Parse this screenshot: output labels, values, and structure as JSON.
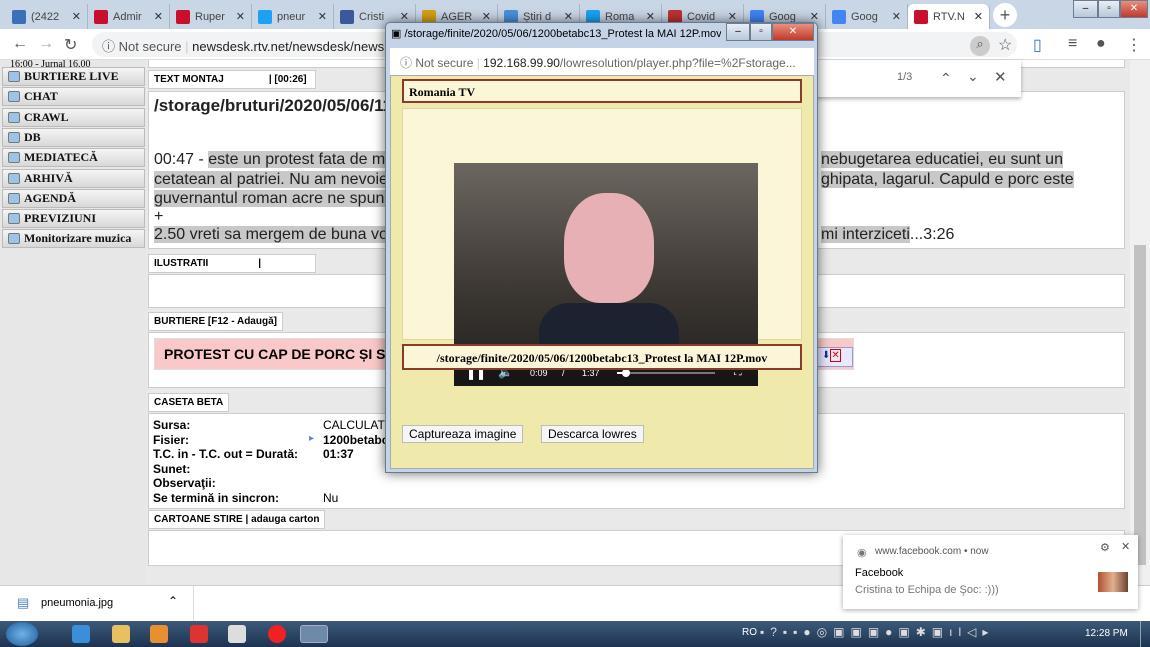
{
  "browser": {
    "tabs": [
      {
        "label": "(2422",
        "icon": "messenger-icon",
        "color": "#3b6fb6"
      },
      {
        "label": "Admir",
        "icon": "r-logo-icon",
        "color": "#c8102e"
      },
      {
        "label": "Ruper",
        "icon": "r-logo-icon",
        "color": "#c8102e"
      },
      {
        "label": "pneur",
        "icon": "twitter-icon",
        "color": "#1da1f2"
      },
      {
        "label": "Cristi",
        "icon": "facebook-icon",
        "color": "#3b5998"
      },
      {
        "label": "AGER",
        "icon": "agerpres-icon",
        "color": "#d4a017"
      },
      {
        "label": "Știri d",
        "icon": "news-icon",
        "color": "#4a90d9"
      },
      {
        "label": "Roma",
        "icon": "twitter-icon",
        "color": "#1da1f2"
      },
      {
        "label": "Covid",
        "icon": "news-icon",
        "color": "#b33"
      },
      {
        "label": "Goog",
        "icon": "google-docs-icon",
        "color": "#4285f4"
      },
      {
        "label": "Goog",
        "icon": "google-docs-icon",
        "color": "#4285f4"
      },
      {
        "label": "RTV.N",
        "icon": "r-logo-icon",
        "color": "#c8102e",
        "active": true
      }
    ],
    "not_secure": "Not secure",
    "url": "newsdesk.rtv.net/newsdesk/news.php",
    "find": {
      "count": "1/3"
    }
  },
  "sidebar": {
    "top_text": "16:00 - Jurnal 16.00",
    "items": [
      {
        "label": "BURTIERE LIVE"
      },
      {
        "label": "CHAT"
      },
      {
        "label": "CRAWL"
      },
      {
        "label": "DB"
      },
      {
        "label": "MEDIATECĂ"
      },
      {
        "label": "ARHIVĂ"
      },
      {
        "label": "AGENDĂ"
      },
      {
        "label": "PREVIZIUNI"
      },
      {
        "label": "Monitorizare muzica"
      }
    ]
  },
  "main": {
    "text_montaj": {
      "label": "TEXT MONTAJ",
      "duration": "| [00:26]",
      "path": "/storage/bruturi/2020/05/06/112",
      "lines": [
        {
          "time": "00:47 - ",
          "left": "este un protest fata de ma",
          "right": "nebugetarea educatiei, eu sunt un"
        },
        {
          "left": "cetatean al patriei. Nu am nevoie",
          "right": "ghipata, lagarul. Capuld e porc este"
        },
        {
          "left": "guvernantul roman acre ne spune",
          "right": ""
        },
        {
          "left": "+",
          "right": ""
        },
        {
          "left": "2.50 vreti sa mergem de buna vo",
          "right": "mi interziceti",
          "tail": "...3:26"
        }
      ]
    },
    "ilustratii": {
      "label": "ILUSTRATII",
      "sep": "|"
    },
    "burtiere": {
      "label": "BURTIERE [F12 - Adaugă]",
      "text": "PROTEST CU CAP DE PORC ȘI SÂ"
    },
    "caseta": {
      "label": "CASETA BETA",
      "rows": [
        {
          "k": "Sursa:",
          "v": "CALCULAT"
        },
        {
          "k": "Fisier:",
          "v": "1200betabc"
        },
        {
          "k": "T.C. in - T.C. out = Durată:",
          "v": "01:37"
        },
        {
          "k": "Sunet:",
          "v": ""
        },
        {
          "k": "Observaţii:",
          "v": ""
        },
        {
          "k": "Se termină in sincron:",
          "v": "Nu"
        }
      ]
    },
    "cartoane": {
      "label": "CARTOANE STIRE",
      "link": "| adauga carton"
    }
  },
  "popup": {
    "title": "/storage/finite/2020/05/06/1200betabc13_Protest la MAI 12P.mov - ...",
    "not_secure": "Not secure",
    "url_host": "192.168.99.90",
    "url_rest": "/lowresolution/player.php?file=%2Fstorage...",
    "channel": "Romania TV",
    "video": {
      "current": "0:09",
      "sep": "/",
      "total": "1:37",
      "progress": 0.09
    },
    "file": "/storage/finite/2020/05/06/1200betabc13_Protest la MAI 12P.mov",
    "capture_btn": "Captureaza imagine",
    "download_btn": "Descarca lowres"
  },
  "download": {
    "file": "pneumonia.jpg"
  },
  "notification": {
    "source": "www.facebook.com",
    "dot": "•",
    "time": "now",
    "title": "Facebook",
    "body": "Cristina to Echipa de Şoc: :)))"
  },
  "taskbar": {
    "lang": "RO",
    "clock": "12:28 PM"
  }
}
